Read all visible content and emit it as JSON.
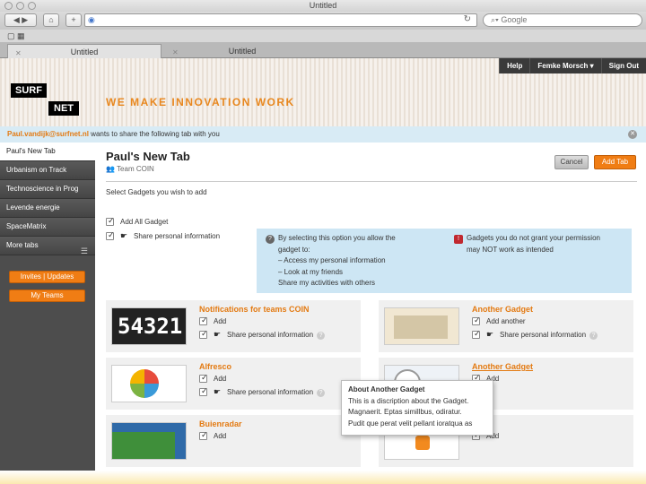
{
  "browser": {
    "window_title": "Untitled",
    "search_placeholder": "Google",
    "tabs": [
      {
        "label": "Untitled"
      },
      {
        "label": "Untitled"
      }
    ]
  },
  "topnav": {
    "items": [
      "Help",
      "Femke Morsch ▾",
      "Sign Out"
    ]
  },
  "logo": {
    "line1": "SURF",
    "line2": "NET"
  },
  "tagline": "WE MAKE INNOVATION WORK",
  "sharebar": {
    "email": "Paul.vandijk@surfnet.nl",
    "text": " wants to share the following tab with you"
  },
  "sidebar": {
    "items": [
      {
        "label": "Paul's New Tab"
      },
      {
        "label": "Urbanism on Track"
      },
      {
        "label": "Technoscience in Prog"
      },
      {
        "label": "Levende energie"
      },
      {
        "label": "SpaceMatrix"
      },
      {
        "label": "More tabs"
      }
    ],
    "buttons": [
      "Invites | Updates",
      "My Teams"
    ]
  },
  "main": {
    "title": "Paul's New Tab",
    "team": "Team COIN",
    "cancel": "Cancel",
    "add_tab": "Add Tab",
    "instruction": "Select Gadgets you wish to add",
    "add_all": "Add All Gadget",
    "share_info": "Share personal information"
  },
  "infobox": {
    "col1": [
      "By selecting this option you allow the",
      "gadget to:",
      "– Access my personal information",
      "– Look at my friends",
      "  Share my activities with others"
    ],
    "col2": [
      "Gadgets you do not grant your permission",
      "may NOT work as intended"
    ]
  },
  "gadgets": [
    {
      "title": "Notifications for teams COIN",
      "add": "Add",
      "share": "Share personal information",
      "thumb_text": "54321"
    },
    {
      "title": "Another Gadget",
      "add": "Add another",
      "share": "Share personal information"
    },
    {
      "title": "Alfresco",
      "add": "Add",
      "share": "Share personal information"
    },
    {
      "title": "Another Gadget",
      "add": "Add",
      "share": ""
    },
    {
      "title": "Buienradar",
      "add": "Add",
      "share": ""
    },
    {
      "title": "",
      "add": "Add",
      "share": ""
    }
  ],
  "tooltip": {
    "lines": [
      "About Another Gadget",
      "This is a discription about the Gadget.",
      "Magnaerit. Eptas simillbus, odiratur.",
      "Pudit que perat velit pellant ioratqua as"
    ]
  },
  "colors": {
    "accent": "#f07d14",
    "dark": "#4d4d4d",
    "info_bg": "#cde6f4"
  }
}
